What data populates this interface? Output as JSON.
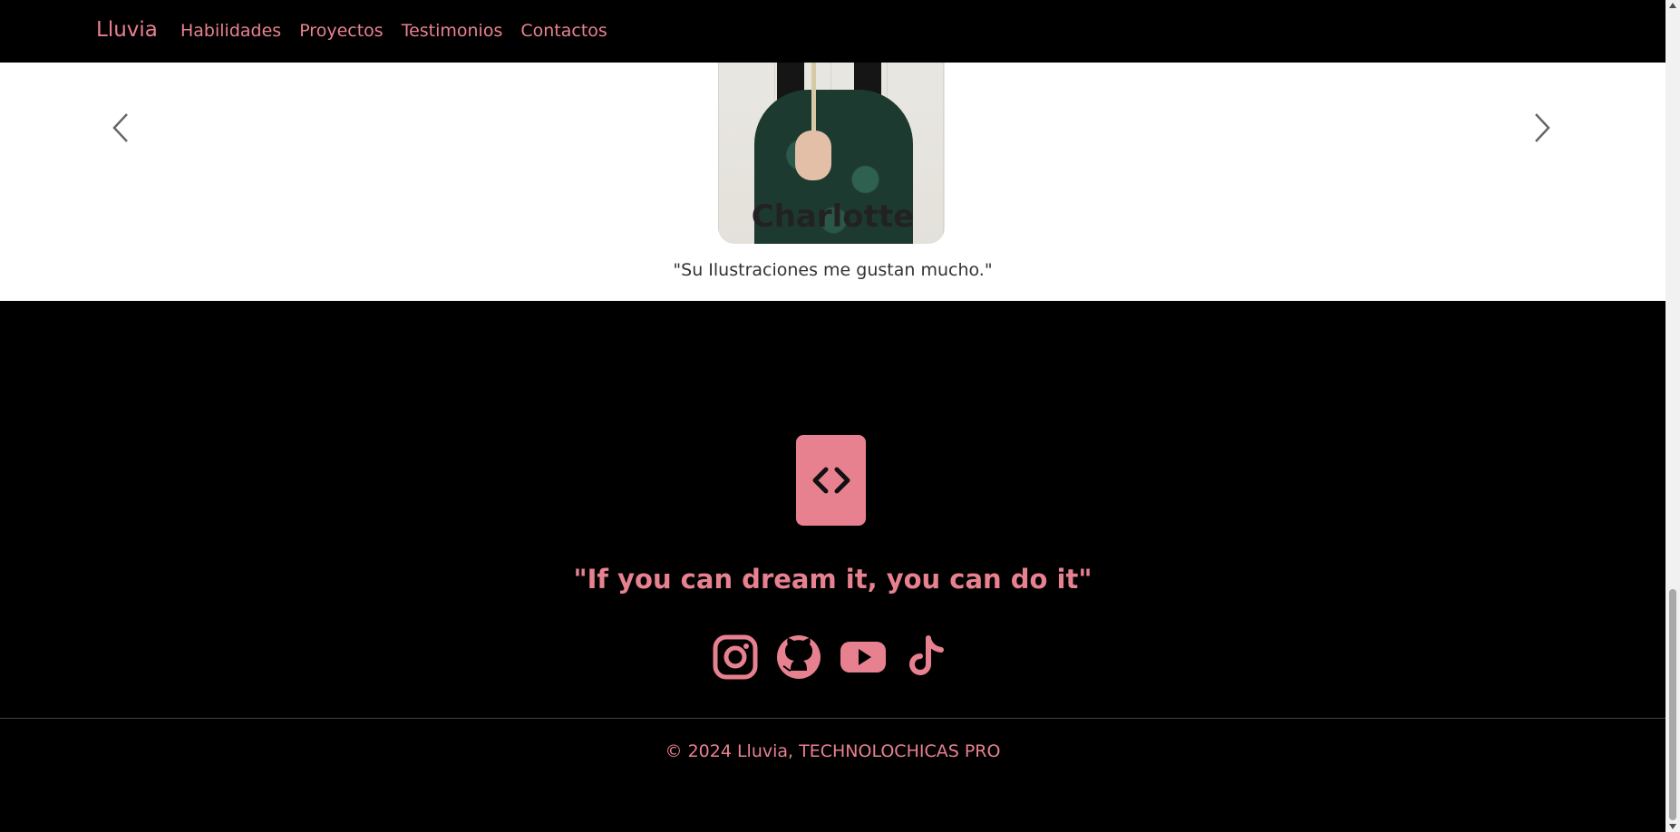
{
  "navbar": {
    "brand": "Lluvia",
    "links": [
      "Habilidades",
      "Proyectos",
      "Testimonios",
      "Contactos"
    ]
  },
  "testimonial": {
    "name": "Charlotte",
    "quote": "\"Su Ilustraciones me gustan mucho.\"",
    "prev_icon": "chevron-left-icon",
    "next_icon": "chevron-right-icon"
  },
  "footer": {
    "logo_icon": "code-icon",
    "motto": "\"If you can dream it, you can do it\"",
    "socials": [
      "instagram-icon",
      "github-icon",
      "youtube-icon",
      "tiktok-icon"
    ],
    "copyright": "© 2024 Lluvia, TECHNOLOCHICAS PRO"
  },
  "colors": {
    "accent": "#e8818f",
    "background": "#000000",
    "section_bg": "#ffffff"
  }
}
